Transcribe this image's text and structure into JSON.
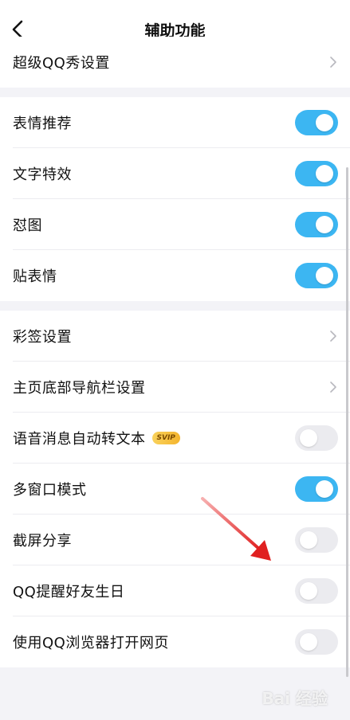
{
  "header": {
    "title": "辅助功能"
  },
  "group1": {
    "items": [
      {
        "label": "超级QQ秀设置"
      }
    ]
  },
  "group2": {
    "items": [
      {
        "label": "表情推荐",
        "toggle": "on"
      },
      {
        "label": "文字特效",
        "toggle": "on"
      },
      {
        "label": "怼图",
        "toggle": "on"
      },
      {
        "label": "贴表情",
        "toggle": "on"
      }
    ]
  },
  "group3": {
    "items": [
      {
        "label": "彩签设置"
      },
      {
        "label": "主页底部导航栏设置"
      },
      {
        "label": "语音消息自动转文本",
        "badge": "SVIP",
        "toggle": "off"
      },
      {
        "label": "多窗口模式",
        "toggle": "on"
      },
      {
        "label": "截屏分享",
        "toggle": "off"
      },
      {
        "label": "QQ提醒好友生日",
        "toggle": "off"
      },
      {
        "label": "使用QQ浏览器打开网页",
        "toggle": "off"
      }
    ]
  },
  "watermark": {
    "text": "Bai 经验"
  },
  "colors": {
    "toggle_on": "#3cb6f2",
    "toggle_off": "#ebebef",
    "background": "#f3f3f7",
    "arrow": "#e02020"
  },
  "icons": {
    "back": "chevron-left-icon",
    "chevron": "chevron-right-icon"
  }
}
